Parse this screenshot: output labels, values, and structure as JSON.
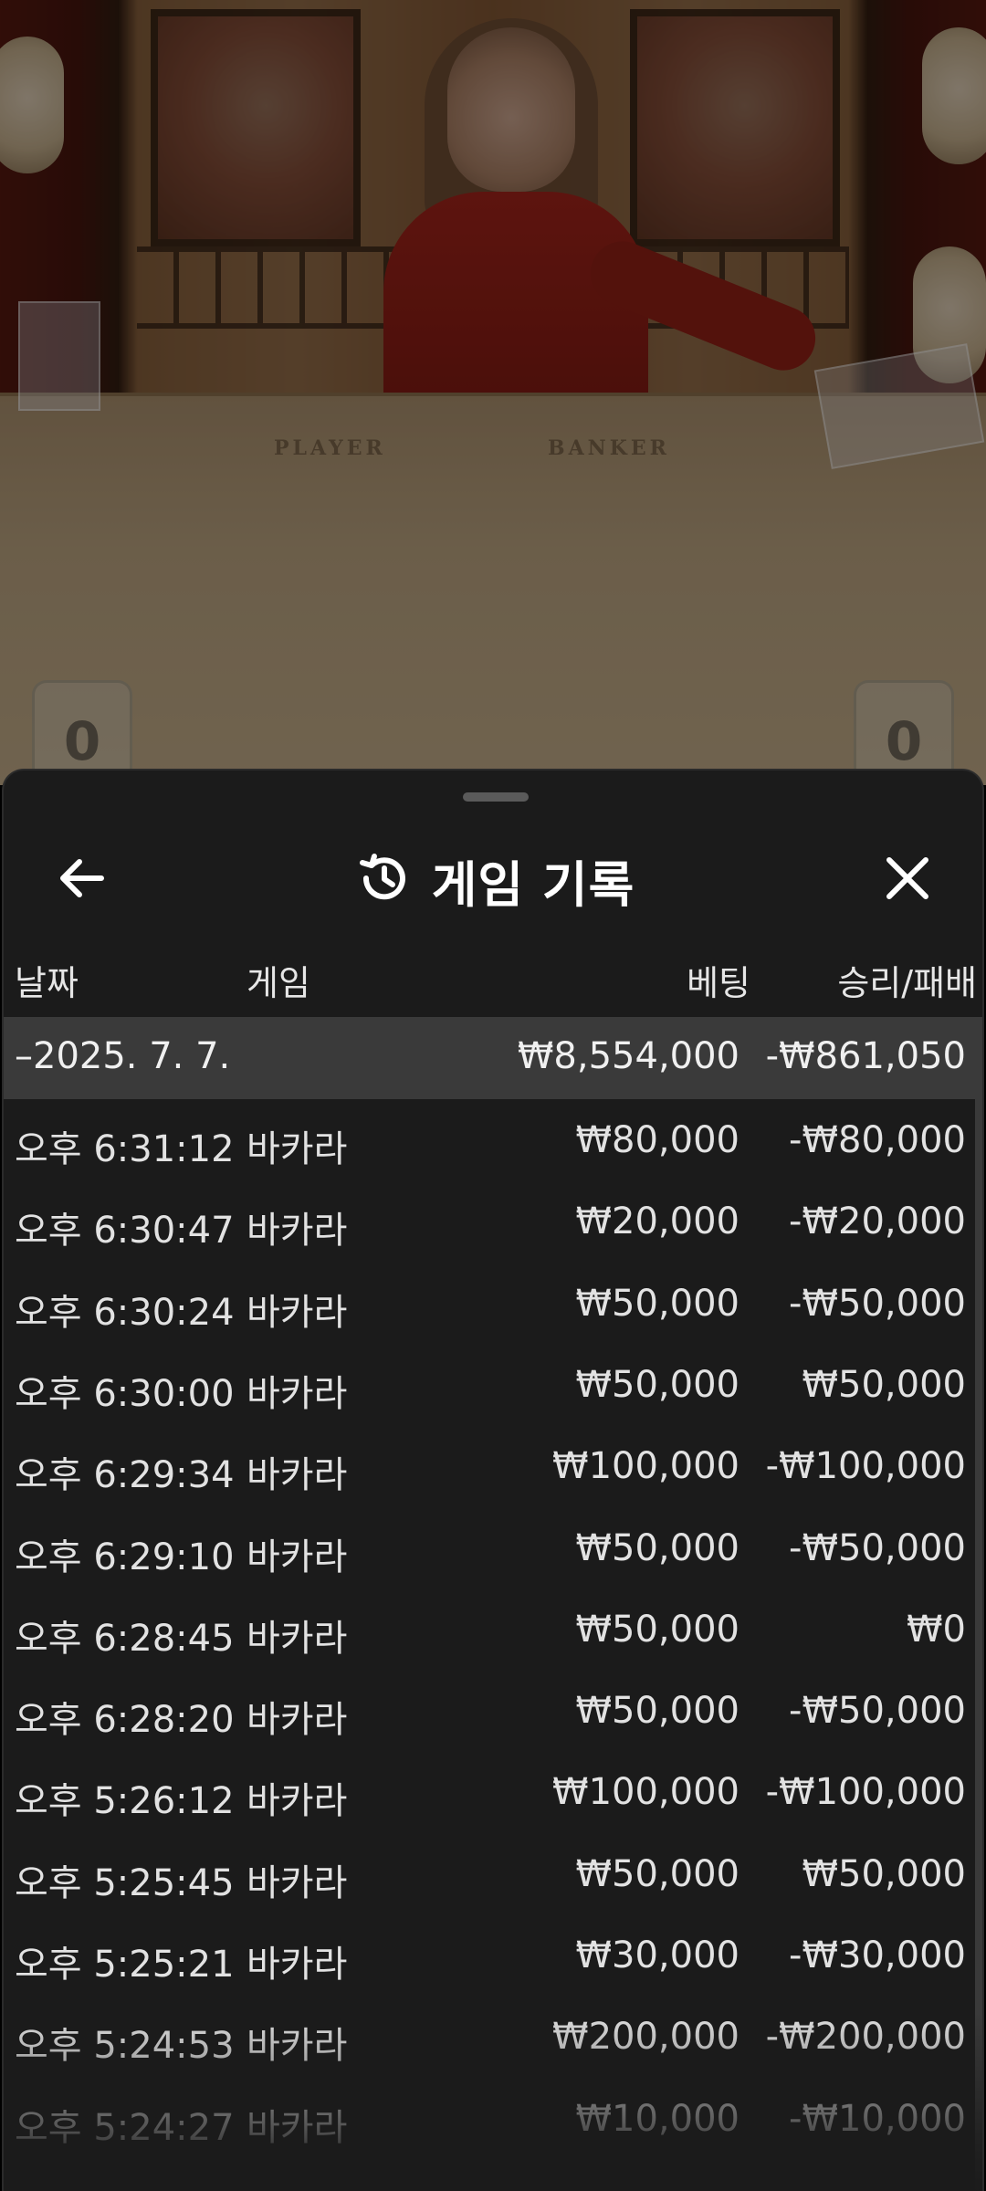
{
  "video": {
    "table_labels": {
      "player": "PLAYER",
      "banker": "BANKER"
    },
    "scores": {
      "left": "0",
      "right": "0"
    }
  },
  "sheet": {
    "title": "게임 기록",
    "icons": {
      "back": "arrow-left-icon",
      "history": "history-icon",
      "close": "close-icon"
    }
  },
  "table": {
    "headers": {
      "date": "날짜",
      "game": "게임",
      "bet": "베팅",
      "winloss": "승리/패배"
    },
    "day": {
      "date": "–2025. 7. 7.",
      "bet": "₩8,554,000",
      "winloss": "-₩861,050"
    },
    "rows": [
      {
        "time": "오후 6:31:12",
        "game": "바카라",
        "bet": "₩80,000",
        "winloss": "-₩80,000"
      },
      {
        "time": "오후 6:30:47",
        "game": "바카라",
        "bet": "₩20,000",
        "winloss": "-₩20,000"
      },
      {
        "time": "오후 6:30:24",
        "game": "바카라",
        "bet": "₩50,000",
        "winloss": "-₩50,000"
      },
      {
        "time": "오후 6:30:00",
        "game": "바카라",
        "bet": "₩50,000",
        "winloss": "₩50,000"
      },
      {
        "time": "오후 6:29:34",
        "game": "바카라",
        "bet": "₩100,000",
        "winloss": "-₩100,000"
      },
      {
        "time": "오후 6:29:10",
        "game": "바카라",
        "bet": "₩50,000",
        "winloss": "-₩50,000"
      },
      {
        "time": "오후 6:28:45",
        "game": "바카라",
        "bet": "₩50,000",
        "winloss": "₩0"
      },
      {
        "time": "오후 6:28:20",
        "game": "바카라",
        "bet": "₩50,000",
        "winloss": "-₩50,000"
      },
      {
        "time": "오후 5:26:12",
        "game": "바카라",
        "bet": "₩100,000",
        "winloss": "-₩100,000"
      },
      {
        "time": "오후 5:25:45",
        "game": "바카라",
        "bet": "₩50,000",
        "winloss": "₩50,000"
      },
      {
        "time": "오후 5:25:21",
        "game": "바카라",
        "bet": "₩30,000",
        "winloss": "-₩30,000"
      },
      {
        "time": "오후 5:24:53",
        "game": "바카라",
        "bet": "₩200,000",
        "winloss": "-₩200,000"
      },
      {
        "time": "오후 5:24:27",
        "game": "바카라",
        "bet": "₩10,000",
        "winloss": "-₩10,000"
      }
    ]
  },
  "colors": {
    "sheet_bg": "#1b1b1b",
    "day_row_bg": "#3a3a3a",
    "text": "#e2e2e2"
  }
}
